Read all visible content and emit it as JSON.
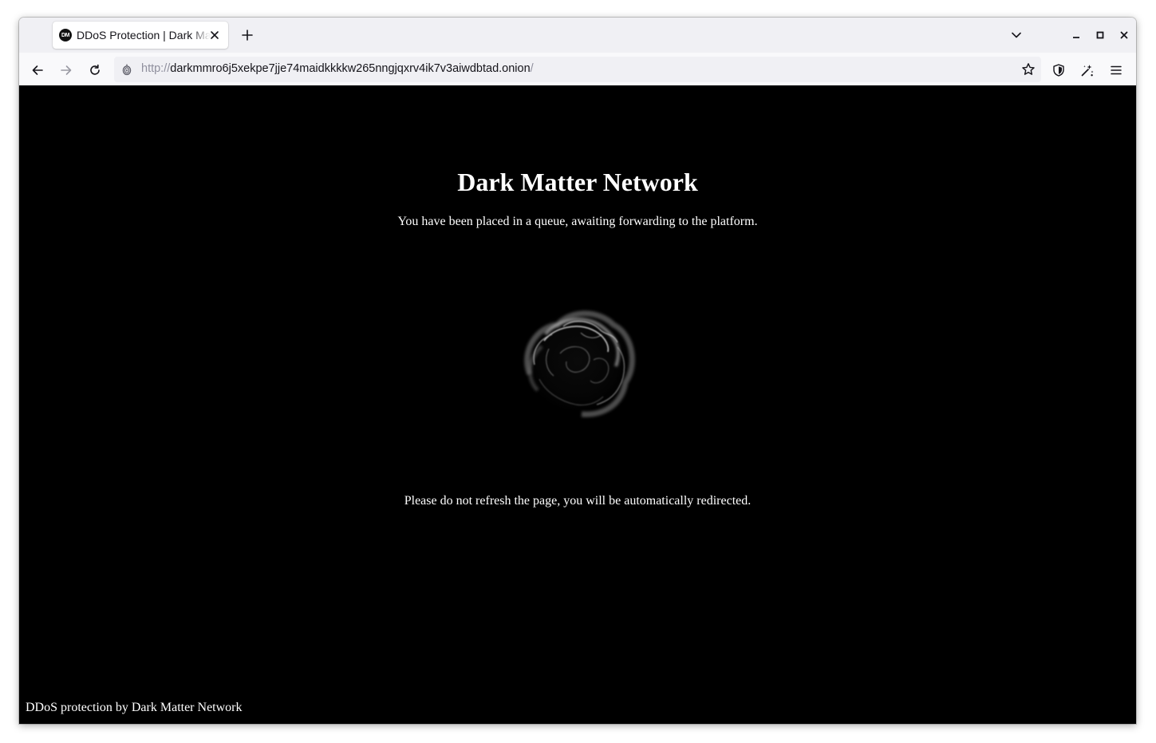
{
  "browser": {
    "tab": {
      "favicon_text": "DM",
      "title": "DDoS Protection | Dark Matter Network"
    },
    "url": {
      "scheme": "http://",
      "host": "darkmmro6j5xekpe7jje74maidkkkkw265nngjqxrv4ik7v3aiwdbtad.onion",
      "path": "/"
    },
    "icons": {
      "tab_close": "close-icon",
      "new_tab": "plus-icon",
      "tab_list": "chevron-down-icon",
      "minimize": "minimize-icon",
      "maximize": "maximize-icon",
      "close_window": "close-icon",
      "back": "arrow-left-icon",
      "forward": "arrow-right-icon",
      "reload": "reload-icon",
      "site_info": "onion-icon",
      "bookmark": "star-icon",
      "shield": "shield-icon",
      "extensions": "magic-wand-icon",
      "menu": "hamburger-icon"
    }
  },
  "page": {
    "title": "Dark Matter Network",
    "queue_message": "You have been placed in a queue, awaiting forwarding to the platform.",
    "redirect_message": "Please do not refresh the page, you will be automatically redirected.",
    "footer": "DDoS protection by Dark Matter Network"
  },
  "colors": {
    "page_background": "#000000",
    "page_text": "#ffffff",
    "chrome_background": "#f0f0f4",
    "toolbar_background": "#f9f9fb"
  }
}
